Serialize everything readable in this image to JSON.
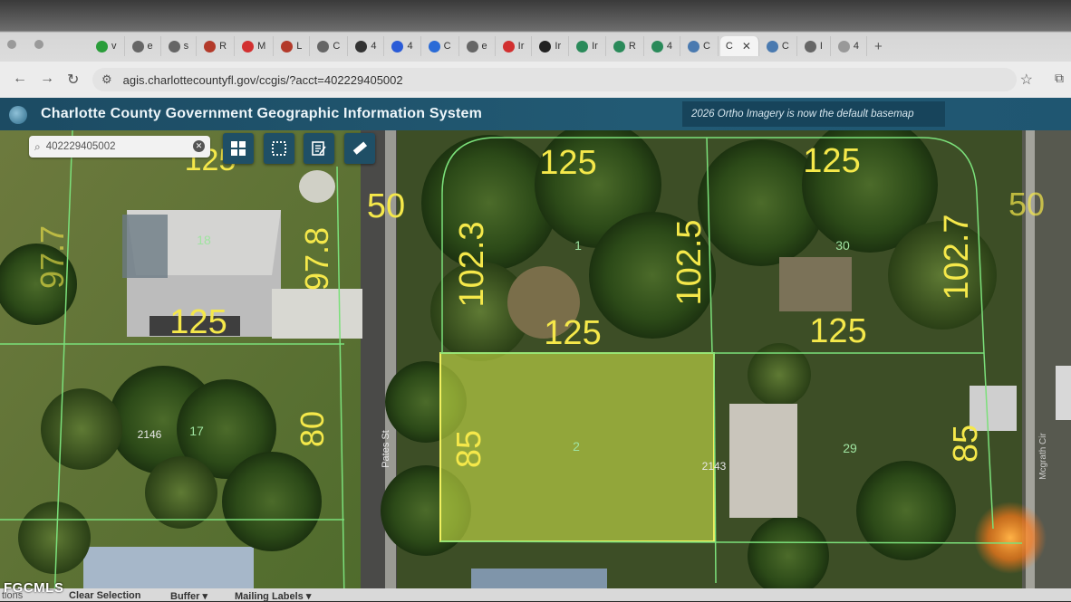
{
  "browser": {
    "tabs": [
      {
        "label": "v",
        "icon": "whatsapp-icon",
        "color": "#2a9d3a"
      },
      {
        "label": "e",
        "icon": "globe-icon",
        "color": "#666666"
      },
      {
        "label": "s",
        "icon": "globe-icon",
        "color": "#666666"
      },
      {
        "label": "R",
        "icon": "redfin-icon",
        "color": "#b33a2a"
      },
      {
        "label": "M",
        "icon": "target-icon",
        "color": "#d23030"
      },
      {
        "label": "L",
        "icon": "cube-icon",
        "color": "#b33a2a"
      },
      {
        "label": "C",
        "icon": "globe-icon",
        "color": "#666666"
      },
      {
        "label": "4",
        "icon": "clock-icon",
        "color": "#333333"
      },
      {
        "label": "4",
        "icon": "zillow-icon",
        "color": "#2a5bd7"
      },
      {
        "label": "C",
        "icon": "square-icon",
        "color": "#2a6bd7"
      },
      {
        "label": "e",
        "icon": "globe-icon",
        "color": "#666666"
      },
      {
        "label": "Ir",
        "icon": "gmail-icon",
        "color": "#d23030"
      },
      {
        "label": "Ir",
        "icon": "v-icon",
        "color": "#222222"
      },
      {
        "label": "Ir",
        "icon": "map-icon",
        "color": "#2a8a5a"
      },
      {
        "label": "R",
        "icon": "map-icon",
        "color": "#2a8a5a"
      },
      {
        "label": "4",
        "icon": "map-icon",
        "color": "#2a8a5a"
      },
      {
        "label": "C",
        "icon": "globe-icon",
        "color": "#4a7ab0"
      },
      {
        "label": "C",
        "icon": "none",
        "color": "#666666",
        "active": true
      },
      {
        "label": "C",
        "icon": "globe-icon",
        "color": "#4a7ab0"
      },
      {
        "label": "I",
        "icon": "globe-icon",
        "color": "#666666"
      },
      {
        "label": "4",
        "icon": "google-icon",
        "color": "#999999"
      }
    ],
    "close_glyph": "✕",
    "new_tab_glyph": "+",
    "url": "agis.charlottecountyfl.gov/ccgis/?acct=402229405002"
  },
  "gis": {
    "title": "Charlotte County Government Geographic Information System",
    "notice": "2026 Ortho Imagery is now the default basemap",
    "search_value": "402229405002"
  },
  "map": {
    "dimensions": {
      "top_left_top": "125",
      "top_left_left": "102.3",
      "top_left_right": "102.5",
      "top_left_bottom": "125",
      "top_right_top": "125",
      "top_right_right": "102.7",
      "top_right_bottom": "125",
      "west_top": "125",
      "west_right": "97.8",
      "west_bottom": "125",
      "west_far_left": "97.7",
      "west_lower_right": "80",
      "street_width_left": "50",
      "street_width_right": "50",
      "selected_left": "85",
      "lower_right_right": "85"
    },
    "lot_numbers": {
      "lot_1": "1",
      "lot_2": "2",
      "lot_30": "30",
      "lot_29": "29",
      "lot_18": "18",
      "lot_17": "17"
    },
    "addresses": {
      "addr_2146": "2146",
      "addr_2143": "2143"
    },
    "streets": {
      "pates": "Pates St",
      "mcgrath": "Mcgrath Cir"
    },
    "colors": {
      "parcel_line": "#7be07a",
      "dimension_text": "#f5e84a",
      "selection_fill": "#d9ee4a",
      "selection_stroke": "#f0f060"
    }
  },
  "bottom": {
    "options": "tions",
    "clear_selection": "Clear Selection",
    "buffer": "Buffer",
    "mailing_labels": "Mailing Labels"
  },
  "watermark": "FGCMLS"
}
